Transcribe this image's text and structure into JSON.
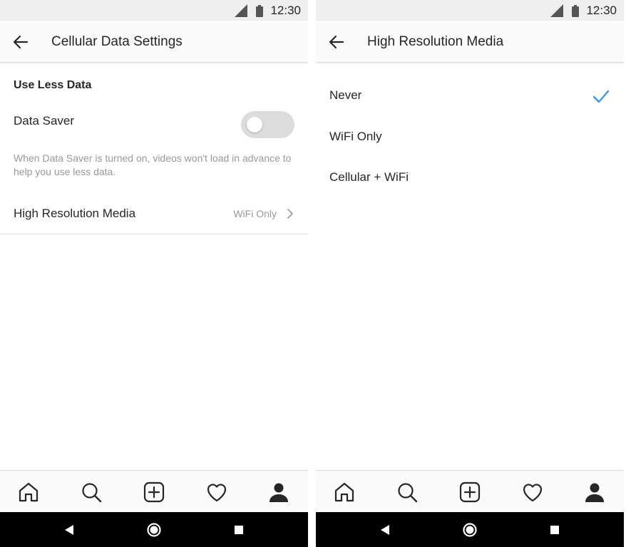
{
  "status_bar": {
    "time": "12:30",
    "signal_icon": "signal-icon",
    "battery_icon": "battery-icon"
  },
  "left_screen": {
    "title": "Cellular Data Settings",
    "back_icon": "arrow-left-icon",
    "section_heading": "Use Less Data",
    "data_saver": {
      "label": "Data Saver",
      "enabled": false
    },
    "helper_text": "When Data Saver is turned on, videos won't load in advance to help you use less data.",
    "high_res_row": {
      "label": "High Resolution Media",
      "value": "WiFi Only",
      "chevron_icon": "chevron-right-icon"
    }
  },
  "right_screen": {
    "title": "High Resolution Media",
    "back_icon": "arrow-left-icon",
    "options": [
      {
        "label": "Never",
        "selected": true
      },
      {
        "label": "WiFi Only",
        "selected": false
      },
      {
        "label": "Cellular + WiFi",
        "selected": false
      }
    ],
    "check_icon": "checkmark-icon"
  },
  "tab_bar": [
    "home-icon",
    "search-icon",
    "add-post-icon",
    "heart-icon",
    "profile-icon"
  ],
  "nav_bar": [
    "back-triangle-icon",
    "home-circle-icon",
    "recents-square-icon"
  ],
  "colors": {
    "accent": "#3897f0",
    "text_primary": "#262626",
    "text_secondary": "#999999",
    "divider": "#dbdbdb",
    "toggle_off": "#dcdcdc",
    "status_bar_bg": "#efefef",
    "nav_bar_bg": "#000000"
  }
}
